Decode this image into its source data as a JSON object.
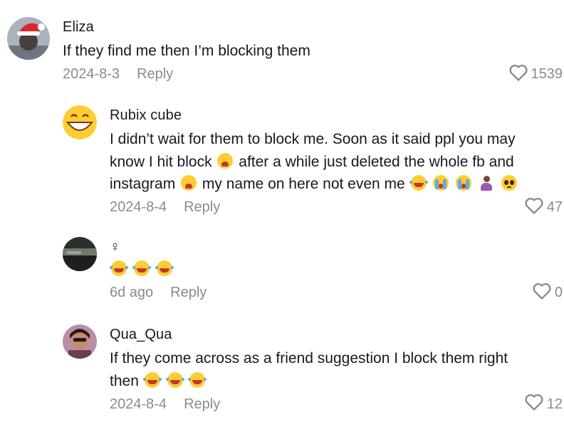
{
  "comments": [
    {
      "author": "Eliza",
      "text": "If they find me then I’m blocking them",
      "date": "2024-8-3",
      "reply_label": "Reply",
      "likes": "1539"
    },
    {
      "author": "Rubix cube",
      "text_parts": [
        "I didn’t wait for them to block me. Soon as it said ppl you may know I hit block",
        "after a while just deleted the whole fb and instagram",
        "my name on here not even me"
      ],
      "date": "2024-8-4",
      "reply_label": "Reply",
      "likes": "47"
    },
    {
      "author": "♀",
      "date": "6d ago",
      "reply_label": "Reply",
      "likes": "0"
    },
    {
      "author": "Qua_Qua",
      "text": "If they come across as a friend suggestion I block them right then",
      "date": "2024-8-4",
      "reply_label": "Reply",
      "likes": "12"
    }
  ],
  "icons": {
    "like": "heart-outline-icon",
    "emoji_laugh": "face-with-tears-of-joy",
    "emoji_tired": "tired-face",
    "emoji_cry": "loudly-crying-face",
    "emoji_person": "person-shrugging",
    "emoji_pleading": "woozy-face"
  },
  "colors": {
    "text": "#161823",
    "meta": "#8a8b91",
    "background": "#ffffff"
  }
}
